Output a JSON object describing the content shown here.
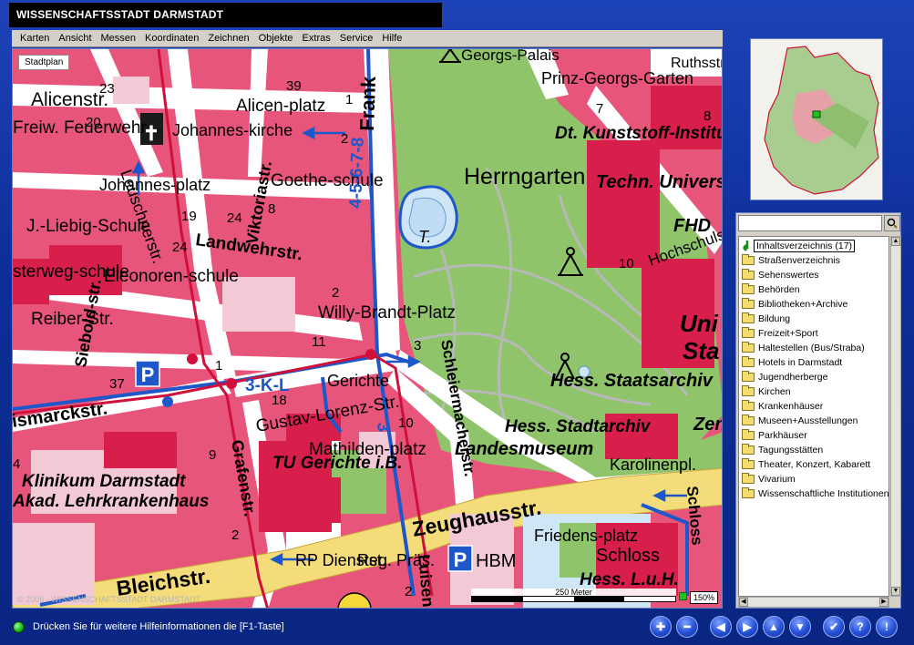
{
  "window": {
    "title": "WISSENSCHAFTSSTADT DARMSTADT"
  },
  "menu": [
    "Karten",
    "Ansicht",
    "Messen",
    "Koordinaten",
    "Zeichnen",
    "Objekte",
    "Extras",
    "Service",
    "Hilfe"
  ],
  "map": {
    "mode_label": "Stadtplan",
    "copyright": "© 2005 - WISSENSCHAFTSSTADT DARMSTADT",
    "scale_label": "250 Meter",
    "zoom": "150%",
    "labels": {
      "georgs_palais": "Georgs-Palais",
      "ruthsstr": "Ruthsstr",
      "prinz_georgs_garten": "Prinz-Georgs-Garten",
      "dt_kunststoff": "Dt. Kunststoff-Institut",
      "techn_uni": "Techn. Universität",
      "fhd": "FHD",
      "hochschulstr": "Hochschulstr.",
      "uni": "Uni",
      "herrngarten": "Herrngarten",
      "alicenstr": "Alicenstr.",
      "alicenplatz": "Alicen-platz",
      "johanneskirche": "Johannes-kirche",
      "goetheschule": "Goethe-schule",
      "viktoriastr": "Viktoriastr.",
      "frankfurter": "Frank",
      "leuschnerstr": "Leuschnerstr.",
      "feuerwehr": "Freiw. Feuerwehr",
      "johannesplatz": "Johannes-platz",
      "liebig_schule": "J.-Liebig-Schule",
      "landwehrstr": "Landwehrstr.",
      "eleonorenschule": "Eleonoren-schule",
      "reiberstr": "Reiber-Str.",
      "sterwegschule": "sterweg-schule",
      "willy_brandt": "Willy-Brandt-Platz",
      "t_label": "T.",
      "siebold_str": "Siebold-str.",
      "kl_line": "3-K-L",
      "gerichte": "Gerichte",
      "gustav_lorenz": "Gustav-Lorenz-Str.",
      "schlierermacher": "Schleiermacherstr.",
      "hess_staatsarchiv": "Hess. Staatsarchiv",
      "hess_stadtarchiv": "Hess. Stadtarchiv",
      "landesmuseum": "Landesmuseum",
      "karolinenpl": "Karolinenpl.",
      "mathildenplatz": "Mathilden-platz",
      "tu_gerichte": "TU Gerichte i.B.",
      "klinikum": "Klinikum Darmstadt",
      "akad": "Akad. Lehrkrankenhaus",
      "bismarckstr": "ismarckstr.",
      "grafenstr": "Grafenstr.",
      "zeughausstr": "Zeughausstr.",
      "bleichstr": "Bleichstr.",
      "rp_dienstst": "RP Dienstst.",
      "reg_praes": "Reg. Präs.",
      "luisenstr": "Luisen",
      "hbm": "HBM",
      "friedensplatz": "Friedens-platz",
      "schloss": "Schloss",
      "hess_lub": "Hess. L.u.H.",
      "schlossgraben": "Schloss",
      "zen": "Zen",
      "sta": "Sta",
      "nums": [
        "23",
        "20",
        "39",
        "1",
        "2",
        "19",
        "24",
        "8",
        "2",
        "1",
        "37",
        "18",
        "9",
        "10",
        "3",
        "2",
        "11",
        "24",
        "10",
        "8",
        "2",
        "4",
        "7"
      ],
      "line_number": "4-5-6-7-8",
      "line_3": "3"
    }
  },
  "sidebar": {
    "search_placeholder": "",
    "root": "Inhaltsverzeichnis (17)",
    "items": [
      "Straßenverzeichnis",
      "Sehenswertes",
      "Behörden",
      "Bibliotheken+Archive",
      "Bildung",
      "Freizeit+Sport",
      "Haltestellen (Bus/Straba)",
      "Hotels in Darmstadt",
      "Jugendherberge",
      "Kirchen",
      "Krankenhäuser",
      "Museen+Ausstellungen",
      "Parkhäuser",
      "Tagungsstätten",
      "Theater, Konzert, Kabarett",
      "Vivarium",
      "Wissenschaftliche Institutionen"
    ]
  },
  "status": {
    "text": "Drücken Sie für weitere Hilfeinformationen die [F1-Taste]"
  },
  "icons": {
    "search": "magnifier-icon",
    "root": "green-arrow-icon",
    "nav": [
      "plus",
      "minus",
      "left",
      "right",
      "up",
      "down",
      "check",
      "help",
      "exclamation"
    ]
  },
  "colors": {
    "building": "#e8557a",
    "park": "#8fc46b",
    "road": "#ffffff",
    "water": "#cfe6f7",
    "tram": "#1d57c9",
    "rail_red": "#d0103a"
  }
}
